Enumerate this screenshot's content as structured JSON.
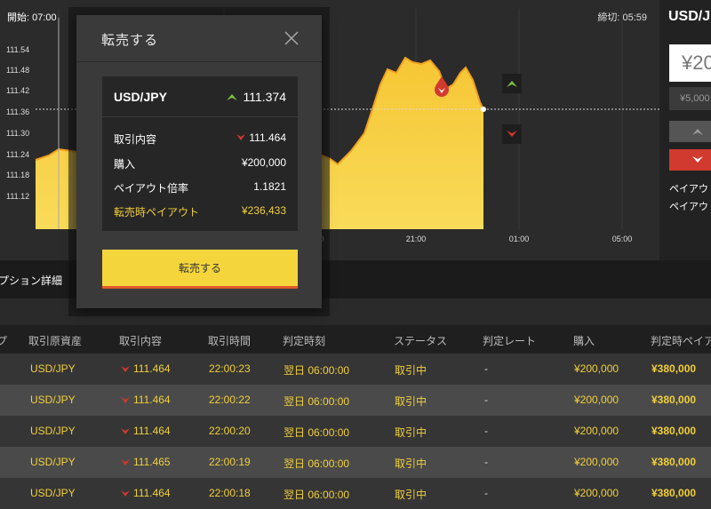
{
  "chart": {
    "open_label": "開始: 07:00",
    "close_label": "締切: 05:59",
    "y_ticks": [
      "111.54",
      "111.48",
      "111.42",
      "111.36",
      "111.30",
      "111.24",
      "111.18",
      "111.12"
    ],
    "x_ticks": [
      "0",
      "21:00",
      "01:00",
      "05:00"
    ],
    "current_rate": 111.374
  },
  "right_panel": {
    "pair": "USD/JPY",
    "amount": "¥20",
    "preset": "¥5,000",
    "payout_label_1": "ペイアウ",
    "payout_label_2": "ペイアウ"
  },
  "details": {
    "title": "プション詳細"
  },
  "table": {
    "headers": [
      "プ",
      "取引原資産",
      "取引内容",
      "取引時間",
      "判定時刻",
      "ステータス",
      "判定レート",
      "購入",
      "判定時ペイア"
    ],
    "rows": [
      {
        "asset": "USD/JPY",
        "rate": "111.464",
        "time": "22:00:23",
        "judge": "翌日 06:00:00",
        "status": "取引中",
        "judge_rate": "-",
        "purchase": "¥200,000",
        "payout": "¥380,000"
      },
      {
        "asset": "USD/JPY",
        "rate": "111.464",
        "time": "22:00:22",
        "judge": "翌日 06:00:00",
        "status": "取引中",
        "judge_rate": "-",
        "purchase": "¥200,000",
        "payout": "¥380,000"
      },
      {
        "asset": "USD/JPY",
        "rate": "111.464",
        "time": "22:00:20",
        "judge": "翌日 06:00:00",
        "status": "取引中",
        "judge_rate": "-",
        "purchase": "¥200,000",
        "payout": "¥380,000"
      },
      {
        "asset": "USD/JPY",
        "rate": "111.465",
        "time": "22:00:19",
        "judge": "翌日 06:00:00",
        "status": "取引中",
        "judge_rate": "-",
        "purchase": "¥200,000",
        "payout": "¥380,000"
      },
      {
        "asset": "USD/JPY",
        "rate": "111.464",
        "time": "22:00:18",
        "judge": "翌日 06:00:00",
        "status": "取引中",
        "judge_rate": "-",
        "purchase": "¥200,000",
        "payout": "¥380,000"
      }
    ]
  },
  "modal": {
    "title": "転売する",
    "pair": "USD/JPY",
    "current_rate": "111.374",
    "details": [
      {
        "label": "取引内容",
        "value": "111.464",
        "arrow": "down"
      },
      {
        "label": "購入",
        "value": "¥200,000"
      },
      {
        "label": "ペイアウト倍率",
        "value": "1.1821"
      },
      {
        "label": "転売時ペイアウト",
        "value": "¥236,433",
        "highlight": true
      }
    ],
    "resell_button": "転売する"
  },
  "colors": {
    "accent_yellow": "#f5d53c",
    "up_green": "#7cc142",
    "down_red": "#d13a2e",
    "highlight_text": "#f0cf3c"
  }
}
